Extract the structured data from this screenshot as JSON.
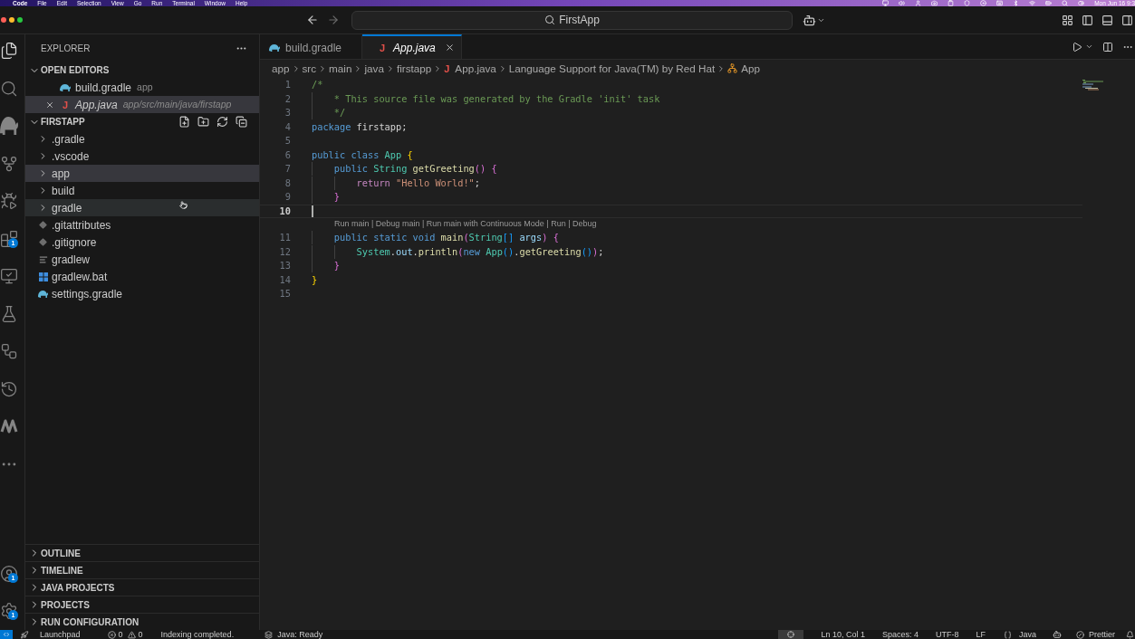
{
  "menu_bar": {
    "items": [
      {
        "label": "Code",
        "bold": true
      },
      {
        "label": "File",
        "bold": false
      },
      {
        "label": "Edit",
        "bold": false
      },
      {
        "label": "Selection",
        "bold": false
      },
      {
        "label": "View",
        "bold": false
      },
      {
        "label": "Go",
        "bold": false
      },
      {
        "label": "Run",
        "bold": false
      },
      {
        "label": "Terminal",
        "bold": false
      },
      {
        "label": "Window",
        "bold": false
      },
      {
        "label": "Help",
        "bold": false
      }
    ],
    "clock": "Mon Jun 16 9:3"
  },
  "title_bar": {
    "command_center": "FirstApp"
  },
  "activity_bar": {
    "items": [
      {
        "kind": "files",
        "selected": true
      },
      {
        "kind": "search",
        "selected": false
      },
      {
        "kind": "gradle",
        "selected": false
      },
      {
        "kind": "source-control",
        "selected": false
      },
      {
        "kind": "run-debug",
        "selected": false
      },
      {
        "kind": "extensions",
        "selected": false,
        "badge": "1"
      },
      {
        "kind": "remote",
        "selected": false
      },
      {
        "kind": "testing",
        "selected": false
      },
      {
        "kind": "actions",
        "selected": false
      },
      {
        "kind": "history",
        "selected": false
      },
      {
        "kind": "zigzag",
        "selected": false
      },
      {
        "kind": "more",
        "selected": false
      }
    ],
    "bottom": [
      {
        "kind": "accounts",
        "badge": "1"
      },
      {
        "kind": "settings",
        "badge": "1"
      }
    ]
  },
  "sidebar": {
    "title": "EXPLORER",
    "open_editors": {
      "title": "OPEN EDITORS",
      "expanded": true,
      "items": [
        {
          "name": "build.gradle",
          "description": "app",
          "kind": "gradle",
          "selected": false,
          "preview": false
        },
        {
          "name": "App.java",
          "description": "app/src/main/java/firstapp",
          "kind": "java",
          "icon": "J",
          "selected": true,
          "preview": true
        }
      ]
    },
    "folder": {
      "title": "FIRSTAPP",
      "expanded": true,
      "items": [
        {
          "name": ".gradle",
          "kind": "folder",
          "expanded": false,
          "selected": false,
          "hovered": false
        },
        {
          "name": ".vscode",
          "kind": "folder",
          "expanded": false,
          "selected": false,
          "hovered": false
        },
        {
          "name": "app",
          "kind": "folder",
          "expanded": false,
          "selected": true,
          "hovered": false
        },
        {
          "name": "build",
          "kind": "folder",
          "expanded": false,
          "selected": false,
          "hovered": false
        },
        {
          "name": "gradle",
          "kind": "folder",
          "expanded": false,
          "selected": false,
          "hovered": true
        },
        {
          "name": ".gitattributes",
          "kind": "git",
          "selected": false,
          "hovered": false
        },
        {
          "name": ".gitignore",
          "kind": "git",
          "selected": false,
          "hovered": false
        },
        {
          "name": "gradlew",
          "kind": "script",
          "selected": false,
          "hovered": false
        },
        {
          "name": "gradlew.bat",
          "kind": "batch",
          "selected": false,
          "hovered": false
        },
        {
          "name": "settings.gradle",
          "kind": "gradle",
          "selected": false,
          "hovered": false
        }
      ]
    },
    "sections": [
      {
        "title": "OUTLINE",
        "expanded": false
      },
      {
        "title": "TIMELINE",
        "expanded": false
      },
      {
        "title": "JAVA PROJECTS",
        "expanded": false
      },
      {
        "title": "PROJECTS",
        "expanded": false
      },
      {
        "title": "RUN CONFIGURATION",
        "expanded": false
      }
    ]
  },
  "editor": {
    "tabs": [
      {
        "label": "build.gradle",
        "kind": "gradle",
        "selected": false,
        "preview": false
      },
      {
        "label": "App.java",
        "kind": "java",
        "icon": "J",
        "selected": true,
        "preview": true
      }
    ],
    "breadcrumbs": [
      {
        "label": "app",
        "kind": "folder"
      },
      {
        "label": "src",
        "kind": "folder"
      },
      {
        "label": "main",
        "kind": "folder"
      },
      {
        "label": "java",
        "kind": "folder"
      },
      {
        "label": "firstapp",
        "kind": "folder"
      },
      {
        "label": "App.java",
        "kind": "java",
        "icon": "J"
      },
      {
        "label": "Language Support for Java(TM) by Red Hat",
        "kind": "text"
      },
      {
        "label": "App",
        "kind": "class"
      }
    ],
    "lines": [
      {
        "number": "1",
        "active": false,
        "tokens": [
          {
            "text": "/*",
            "kind": "comment"
          }
        ]
      },
      {
        "number": "2",
        "active": false,
        "tokens": [
          {
            "text": " * This source file was generated by the Gradle 'init' task",
            "kind": "comment"
          }
        ]
      },
      {
        "number": "3",
        "active": false,
        "tokens": [
          {
            "text": " */",
            "kind": "comment"
          }
        ]
      },
      {
        "number": "4",
        "active": false,
        "tokens": [
          {
            "text": "package ",
            "kind": "keyword"
          },
          {
            "text": "firstapp;",
            "kind": "plain"
          }
        ]
      },
      {
        "number": "5",
        "active": false
      },
      {
        "number": "6",
        "active": false,
        "tokens": [
          {
            "text": "public class ",
            "kind": "keyword"
          },
          {
            "text": "App ",
            "kind": "type"
          },
          {
            "text": "{",
            "kind": "bracket1"
          }
        ]
      },
      {
        "number": "7",
        "active": false,
        "tokens": [
          {
            "text": "    public ",
            "kind": "keyword"
          },
          {
            "text": "String ",
            "kind": "type"
          },
          {
            "text": "getGreeting",
            "kind": "function"
          },
          {
            "text": "() {",
            "kind": "bracket2"
          }
        ]
      },
      {
        "number": "8",
        "active": false,
        "tokens": [
          {
            "text": "        return ",
            "kind": "control"
          },
          {
            "text": "\"Hello World!\"",
            "kind": "string"
          },
          {
            "text": ";",
            "kind": "plain"
          }
        ]
      },
      {
        "number": "9",
        "active": false,
        "tokens": [
          {
            "text": "    }",
            "kind": "bracket2"
          }
        ]
      },
      {
        "number": "10",
        "active": true
      },
      {
        "number": "11",
        "active": false,
        "codelens": "Run main | Debug main | Run main with Continuous Mode | Run | Debug",
        "tokens": [
          {
            "text": "    public static void ",
            "kind": "keyword"
          },
          {
            "text": "main",
            "kind": "function"
          },
          {
            "text": "(",
            "kind": "bracket2"
          },
          {
            "text": "String",
            "kind": "type"
          },
          {
            "text": "[] ",
            "kind": "bracket3"
          },
          {
            "text": "args",
            "kind": "variable"
          },
          {
            "text": ") {",
            "kind": "bracket2"
          }
        ]
      },
      {
        "number": "12",
        "active": false,
        "tokens": [
          {
            "text": "        System",
            "kind": "type"
          },
          {
            "text": ".",
            "kind": "plain"
          },
          {
            "text": "out",
            "kind": "variable"
          },
          {
            "text": ".",
            "kind": "plain"
          },
          {
            "text": "println",
            "kind": "function"
          },
          {
            "text": "(",
            "kind": "bracket2"
          },
          {
            "text": "new ",
            "kind": "keyword"
          },
          {
            "text": "App",
            "kind": "type"
          },
          {
            "text": "()",
            "kind": "bracket3"
          },
          {
            "text": ".",
            "kind": "plain"
          },
          {
            "text": "getGreeting",
            "kind": "function"
          },
          {
            "text": "()",
            "kind": "bracket3"
          },
          {
            "text": ")",
            "kind": "bracket2"
          },
          {
            "text": ";",
            "kind": "plain"
          }
        ]
      },
      {
        "number": "13",
        "active": false,
        "tokens": [
          {
            "text": "    }",
            "kind": "bracket2"
          }
        ]
      },
      {
        "number": "14",
        "active": false,
        "tokens": [
          {
            "text": "}",
            "kind": "bracket1"
          }
        ]
      },
      {
        "number": "15",
        "active": false
      }
    ]
  },
  "status_bar": {
    "left": [
      {
        "kind": "remote"
      },
      {
        "kind": "launchpad",
        "text": "Launchpad"
      },
      {
        "kind": "errors",
        "text": "0"
      },
      {
        "kind": "warnings",
        "text": "0"
      },
      {
        "kind": "message",
        "text": "Indexing completed."
      },
      {
        "kind": "java",
        "text": "Java: Ready"
      }
    ],
    "right": [
      {
        "kind": "target"
      },
      {
        "kind": "plain",
        "text": "Ln 10, Col 1"
      },
      {
        "kind": "plain",
        "text": "Spaces: 4"
      },
      {
        "kind": "plain",
        "text": "UTF-8"
      },
      {
        "kind": "plain",
        "text": "LF"
      },
      {
        "kind": "language",
        "text": "Java"
      },
      {
        "kind": "copilot"
      },
      {
        "kind": "prettier",
        "text": "Prettier"
      },
      {
        "kind": "bell"
      }
    ]
  }
}
